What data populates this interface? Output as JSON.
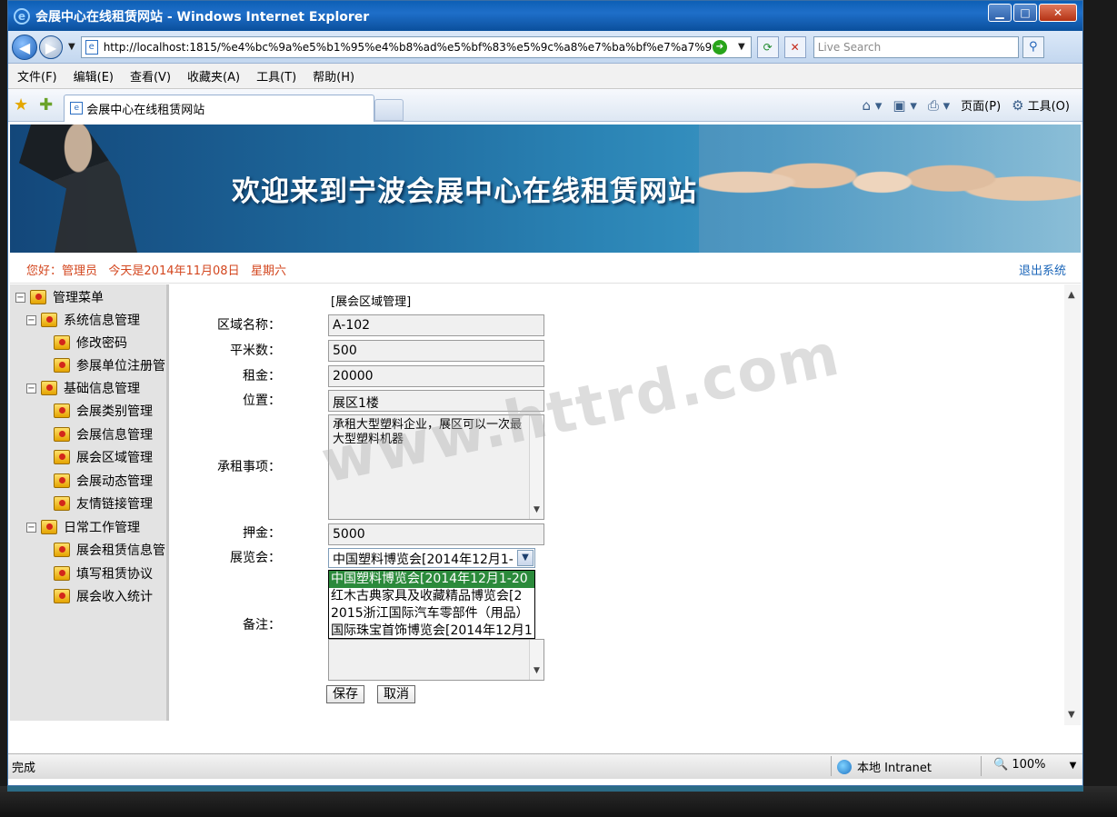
{
  "window": {
    "title": "会展中心在线租赁网站 - Windows Internet Explorer",
    "controls": [
      "▁",
      "□",
      "✕"
    ]
  },
  "address": {
    "url": "http://localhost:1815/%e4%bc%9a%e5%b1%95%e4%b8%ad%e5%bf%83%e5%9c%a8%e7%ba%bf%e7%a7%9f",
    "search_placeholder": "Live Search"
  },
  "menu": [
    "文件(F)",
    "编辑(E)",
    "查看(V)",
    "收藏夹(A)",
    "工具(T)",
    "帮助(H)"
  ],
  "tab": {
    "title": "会展中心在线租赁网站"
  },
  "toolbar": {
    "page_label": "页面(P)",
    "tools_label": "工具(O)"
  },
  "banner": {
    "headline": "欢迎来到宁波会展中心在线租赁网站"
  },
  "greeting": {
    "text": "您好：管理员   今天是2014年11月08日   星期六",
    "logout": "退出系统"
  },
  "sidebar": {
    "root": "管理菜单",
    "groups": [
      {
        "label": "系统信息管理",
        "items": [
          "修改密码",
          "参展单位注册管"
        ]
      },
      {
        "label": "基础信息管理",
        "items": [
          "会展类别管理",
          "会展信息管理",
          "展会区域管理",
          "会展动态管理",
          "友情链接管理"
        ]
      },
      {
        "label": "日常工作管理",
        "items": [
          "展会租赁信息管",
          "填写租赁协议",
          "展会收入统计"
        ]
      }
    ]
  },
  "form": {
    "crumb": "[展会区域管理]",
    "fields": {
      "area_name": {
        "label": "区域名称：",
        "value": "A-102"
      },
      "sqm": {
        "label": "平米数：",
        "value": "500"
      },
      "rent": {
        "label": "租金：",
        "value": "20000"
      },
      "location": {
        "label": "位置：",
        "value": "展区1楼"
      },
      "terms": {
        "label": "承租事项：",
        "value": "承租大型塑料企业，展区可以一次最大型塑料机器"
      },
      "deposit": {
        "label": "押金：",
        "value": "5000"
      },
      "expo": {
        "label": "展览会：",
        "value": "中国塑料博览会[2014年12月1-"
      },
      "remark": {
        "label": "备注：",
        "value": ""
      }
    },
    "expo_options": [
      "中国塑料博览会[2014年12月1-20",
      "红木古典家具及收藏精品博览会[2",
      "2015浙江国际汽车零部件（用品）",
      "国际珠宝首饰博览会[2014年12月1"
    ],
    "save": "保存",
    "cancel": "取消"
  },
  "watermark": "www.httrd.com",
  "status": {
    "text": "完成",
    "zone": "本地 Intranet",
    "zoom": "100%"
  }
}
